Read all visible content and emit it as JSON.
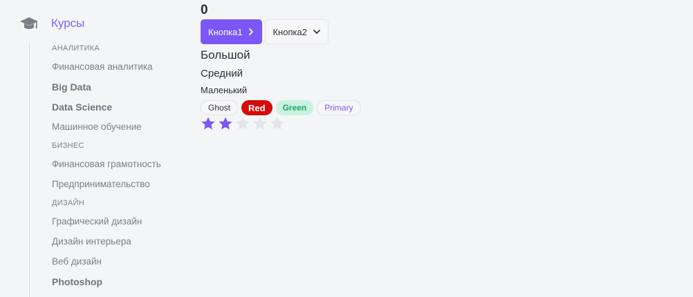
{
  "sidebar": {
    "title": "Курсы",
    "icon": "graduation-cap-icon",
    "accent": "#7b61ff",
    "nav": [
      {
        "type": "category",
        "label": "Аналитика"
      },
      {
        "type": "item",
        "label": "Финансовая аналитика",
        "bold": false
      },
      {
        "type": "item",
        "label": "Big Data",
        "bold": true
      },
      {
        "type": "item",
        "label": "Data Science",
        "bold": true
      },
      {
        "type": "item",
        "label": "Машинное обучение",
        "bold": false
      },
      {
        "type": "category",
        "label": "Бизнес"
      },
      {
        "type": "item",
        "label": "Финансовая грамотность",
        "bold": false
      },
      {
        "type": "item",
        "label": "Предпринимательство",
        "bold": false
      },
      {
        "type": "category",
        "label": "Дизайн"
      },
      {
        "type": "item",
        "label": "Графический дизайн",
        "bold": false
      },
      {
        "type": "item",
        "label": "Дизайн интерьера",
        "bold": false
      },
      {
        "type": "item",
        "label": "Веб дизайн",
        "bold": false
      },
      {
        "type": "item",
        "label": "Photoshop",
        "bold": true
      }
    ]
  },
  "main": {
    "counter": "0",
    "buttons": {
      "button1_label": "Кнопка1",
      "button1_icon": "chevron-right-icon",
      "button2_label": "Кнопка2",
      "button2_icon": "chevron-down-icon",
      "primary_color": "#7b57f5"
    },
    "text_sizes": {
      "large": "Большой",
      "medium": "Средний",
      "small": "Маленький"
    },
    "tags": {
      "ghost": "Ghost",
      "red": "Red",
      "green": "Green",
      "primary": "Primary"
    },
    "rating": {
      "value": 2,
      "max": 5,
      "filled_color": "#7b57f5",
      "empty_color": "#e4e5e9"
    }
  }
}
